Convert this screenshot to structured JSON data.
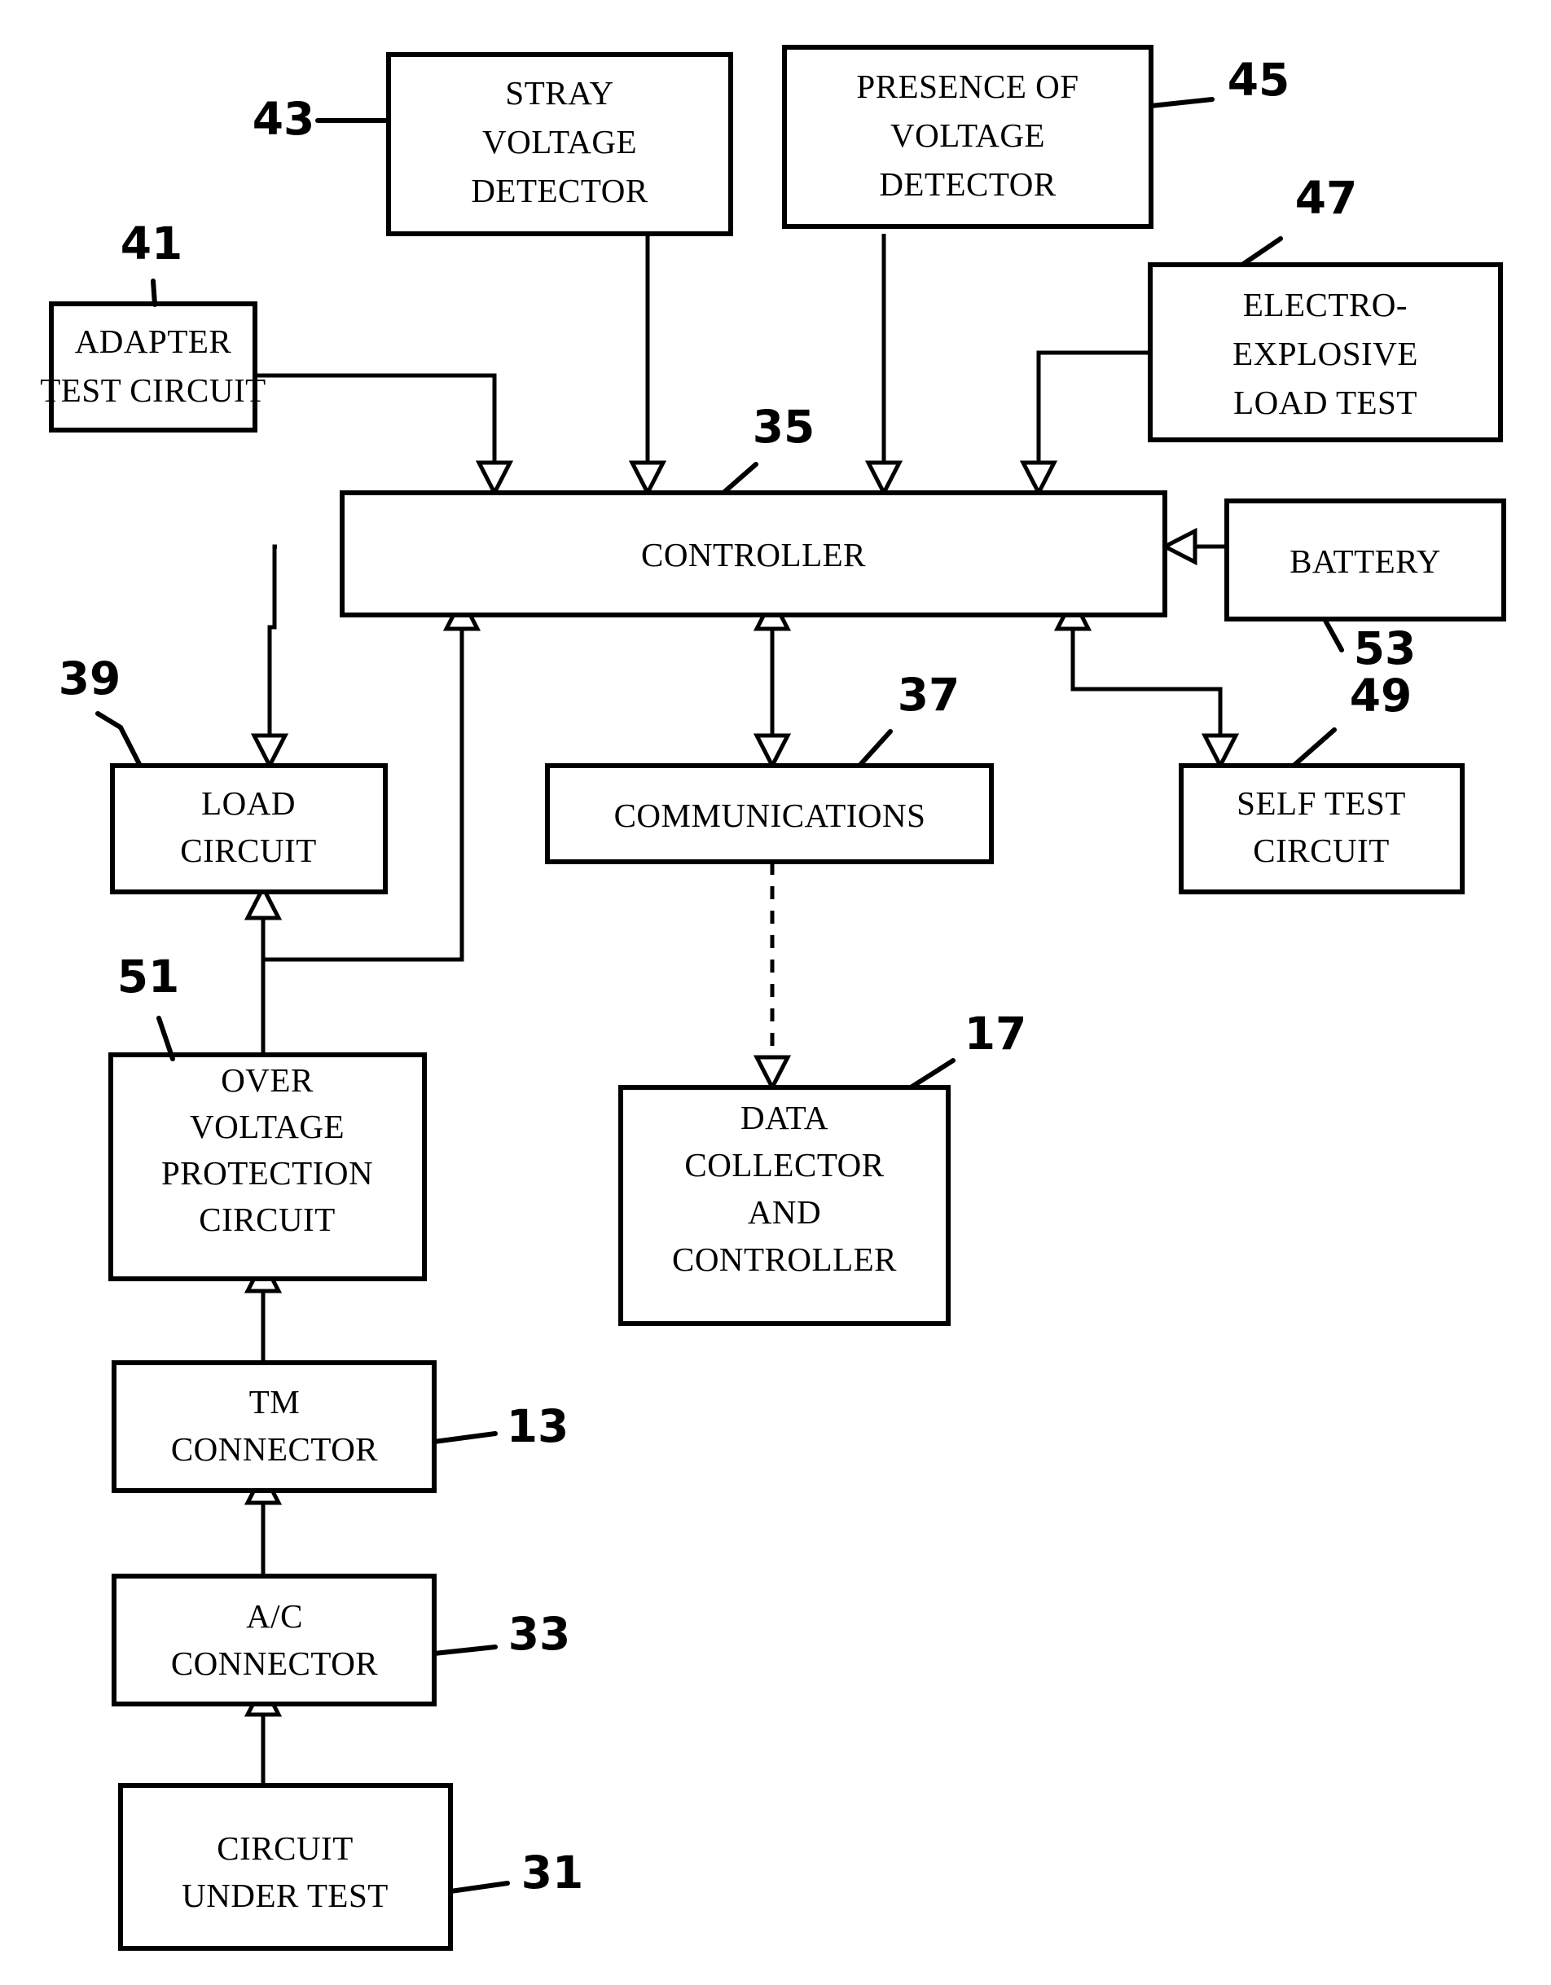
{
  "figure": {
    "type": "patent-block-diagram",
    "title": "Circuit test apparatus block diagram"
  },
  "blocks": [
    {
      "id": "stray_voltage_detector",
      "lines": [
        "STRAY",
        "VOLTAGE",
        "DETECTOR"
      ],
      "ref": "43"
    },
    {
      "id": "presence_of_voltage_detector",
      "lines": [
        "PRESENCE OF",
        "VOLTAGE",
        "DETECTOR"
      ],
      "ref": "45"
    },
    {
      "id": "adapter_test_circuit",
      "lines": [
        "ADAPTER",
        "TEST CIRCUIT"
      ],
      "ref": "41"
    },
    {
      "id": "electro_explosive_load_test",
      "lines": [
        "ELECTRO-",
        "EXPLOSIVE",
        "LOAD TEST"
      ],
      "ref": "47"
    },
    {
      "id": "controller",
      "lines": [
        "CONTROLLER"
      ],
      "ref": "35"
    },
    {
      "id": "battery",
      "lines": [
        "BATTERY"
      ],
      "ref": "53"
    },
    {
      "id": "load_circuit",
      "lines": [
        "LOAD",
        "CIRCUIT"
      ],
      "ref": "39"
    },
    {
      "id": "communications",
      "lines": [
        "COMMUNICATIONS"
      ],
      "ref": "37"
    },
    {
      "id": "self_test_circuit",
      "lines": [
        "SELF TEST",
        "CIRCUIT"
      ],
      "ref": "49"
    },
    {
      "id": "over_voltage_protection_circuit",
      "lines": [
        "OVER",
        "VOLTAGE",
        "PROTECTION",
        "CIRCUIT"
      ],
      "ref": "51"
    },
    {
      "id": "data_collector_and_controller",
      "lines": [
        "DATA",
        "COLLECTOR",
        "AND",
        "CONTROLLER"
      ],
      "ref": "17"
    },
    {
      "id": "tm_connector",
      "lines": [
        "TM",
        "CONNECTOR"
      ],
      "ref": "13"
    },
    {
      "id": "ac_connector",
      "lines": [
        "A/C",
        "CONNECTOR"
      ],
      "ref": "33"
    },
    {
      "id": "circuit_under_test",
      "lines": [
        "CIRCUIT",
        "UNDER TEST"
      ],
      "ref": "31"
    }
  ],
  "labels": {
    "stray_voltage_detector_l1": "STRAY",
    "stray_voltage_detector_l2": "VOLTAGE",
    "stray_voltage_detector_l3": "DETECTOR",
    "presence_of_voltage_detector_l1": "PRESENCE OF",
    "presence_of_voltage_detector_l2": "VOLTAGE",
    "presence_of_voltage_detector_l3": "DETECTOR",
    "adapter_test_circuit_l1": "ADAPTER",
    "adapter_test_circuit_l2": "TEST CIRCUIT",
    "electro_explosive_load_test_l1": "ELECTRO-",
    "electro_explosive_load_test_l2": "EXPLOSIVE",
    "electro_explosive_load_test_l3": "LOAD TEST",
    "controller_l1": "CONTROLLER",
    "battery_l1": "BATTERY",
    "load_circuit_l1": "LOAD",
    "load_circuit_l2": "CIRCUIT",
    "communications_l1": "COMMUNICATIONS",
    "self_test_circuit_l1": "SELF TEST",
    "self_test_circuit_l2": "CIRCUIT",
    "over_voltage_protection_circuit_l1": "OVER",
    "over_voltage_protection_circuit_l2": "VOLTAGE",
    "over_voltage_protection_circuit_l3": "PROTECTION",
    "over_voltage_protection_circuit_l4": "CIRCUIT",
    "data_collector_and_controller_l1": "DATA",
    "data_collector_and_controller_l2": "COLLECTOR",
    "data_collector_and_controller_l3": "AND",
    "data_collector_and_controller_l4": "CONTROLLER",
    "tm_connector_l1": "TM",
    "tm_connector_l2": "CONNECTOR",
    "ac_connector_l1": "A/C",
    "ac_connector_l2": "CONNECTOR",
    "circuit_under_test_l1": "CIRCUIT",
    "circuit_under_test_l2": "UNDER TEST"
  },
  "reference_numerals": {
    "ref_43": "43",
    "ref_45": "45",
    "ref_41": "41",
    "ref_47": "47",
    "ref_35": "35",
    "ref_53": "53",
    "ref_39": "39",
    "ref_37": "37",
    "ref_49": "49",
    "ref_51": "51",
    "ref_17": "17",
    "ref_13": "13",
    "ref_33": "33",
    "ref_31": "31"
  },
  "connections": [
    {
      "from": "stray_voltage_detector",
      "to": "controller",
      "style": "solid",
      "arrow": "single"
    },
    {
      "from": "presence_of_voltage_detector",
      "to": "controller",
      "style": "solid",
      "arrow": "single"
    },
    {
      "from": "adapter_test_circuit",
      "to": "controller",
      "style": "solid",
      "arrow": "single"
    },
    {
      "from": "electro_explosive_load_test",
      "to": "controller",
      "style": "solid",
      "arrow": "single"
    },
    {
      "from": "battery",
      "to": "controller",
      "style": "solid",
      "arrow": "single"
    },
    {
      "from": "controller",
      "to": "load_circuit",
      "style": "solid",
      "arrow": "single"
    },
    {
      "from": "controller",
      "to": "communications",
      "style": "solid",
      "arrow": "single"
    },
    {
      "from": "communications",
      "to": "controller",
      "style": "solid",
      "arrow": "single"
    },
    {
      "from": "controller",
      "to": "self_test_circuit",
      "style": "solid",
      "arrow": "single"
    },
    {
      "from": "over_voltage_protection_circuit",
      "to": "load_circuit",
      "style": "solid",
      "arrow": "single"
    },
    {
      "from": "over_voltage_protection_circuit",
      "to": "controller",
      "style": "solid",
      "arrow": "single"
    },
    {
      "from": "communications",
      "to": "data_collector_and_controller",
      "style": "dashed",
      "arrow": "single"
    },
    {
      "from": "tm_connector",
      "to": "over_voltage_protection_circuit",
      "style": "solid",
      "arrow": "single"
    },
    {
      "from": "ac_connector",
      "to": "tm_connector",
      "style": "solid",
      "arrow": "single"
    },
    {
      "from": "circuit_under_test",
      "to": "ac_connector",
      "style": "solid",
      "arrow": "single"
    }
  ],
  "colors": {
    "ink": "#000000",
    "paper": "#ffffff"
  }
}
